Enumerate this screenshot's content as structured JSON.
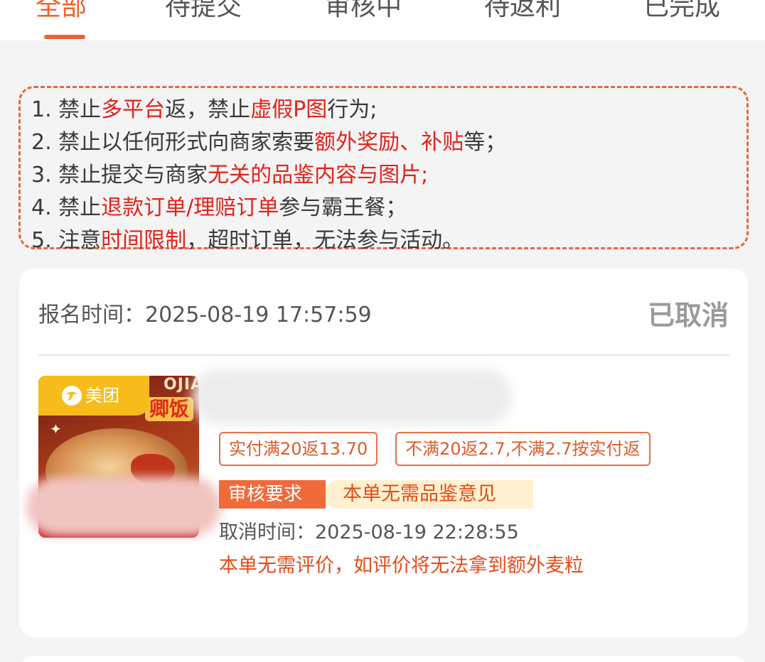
{
  "tabs": [
    {
      "label": "全部",
      "active": true
    },
    {
      "label": "待提交",
      "active": false
    },
    {
      "label": "审核中",
      "active": false
    },
    {
      "label": "待返利",
      "active": false
    },
    {
      "label": "已完成",
      "active": false
    }
  ],
  "rules": [
    {
      "segments": [
        {
          "t": "1. 禁止",
          "hl": false
        },
        {
          "t": "多平台",
          "hl": true
        },
        {
          "t": "返，禁止",
          "hl": false
        },
        {
          "t": "虚假P图",
          "hl": true
        },
        {
          "t": "行为;",
          "hl": false
        }
      ]
    },
    {
      "segments": [
        {
          "t": "2. 禁止以任何形式向商家索要",
          "hl": false
        },
        {
          "t": "额外奖励、补贴",
          "hl": true
        },
        {
          "t": "等；",
          "hl": false
        }
      ]
    },
    {
      "segments": [
        {
          "t": "3. 禁止提交与商家",
          "hl": false
        },
        {
          "t": "无关的品鉴内容与图片;",
          "hl": true
        }
      ]
    },
    {
      "segments": [
        {
          "t": "4. 禁止",
          "hl": false
        },
        {
          "t": "退款订单/理赔订单",
          "hl": true
        },
        {
          "t": "参与霸王餐；",
          "hl": false
        }
      ]
    },
    {
      "segments": [
        {
          "t": "5. 注意",
          "hl": false
        },
        {
          "t": "时间限制",
          "hl": true
        },
        {
          "t": "，超时订单，无法参与活动。",
          "hl": false
        }
      ]
    }
  ],
  "order": {
    "signup_time": "报名时间：2025-08-19 17:57:59",
    "status": "已取消",
    "platform_badge": "美团",
    "thumb_top_text": "OJIA",
    "thumb_word": "卿饭",
    "tags": [
      "实付满20返13.70",
      "不满20返2.7,不满2.7按实付返"
    ],
    "review_label": "审核要求",
    "review_value": "本单无需品鉴意见",
    "cancel_time": "取消时间：2025-08-19 22:28:55",
    "note": "本单无需评价，如评价将无法拿到额外麦粒"
  },
  "colors": {
    "accent": "#f0602e",
    "highlight_red": "#e2231a",
    "meituan_yellow": "#f5bc1b",
    "status_gray": "#9a9a9a"
  },
  "icons": {
    "platform": "meituan-logo-icon"
  }
}
